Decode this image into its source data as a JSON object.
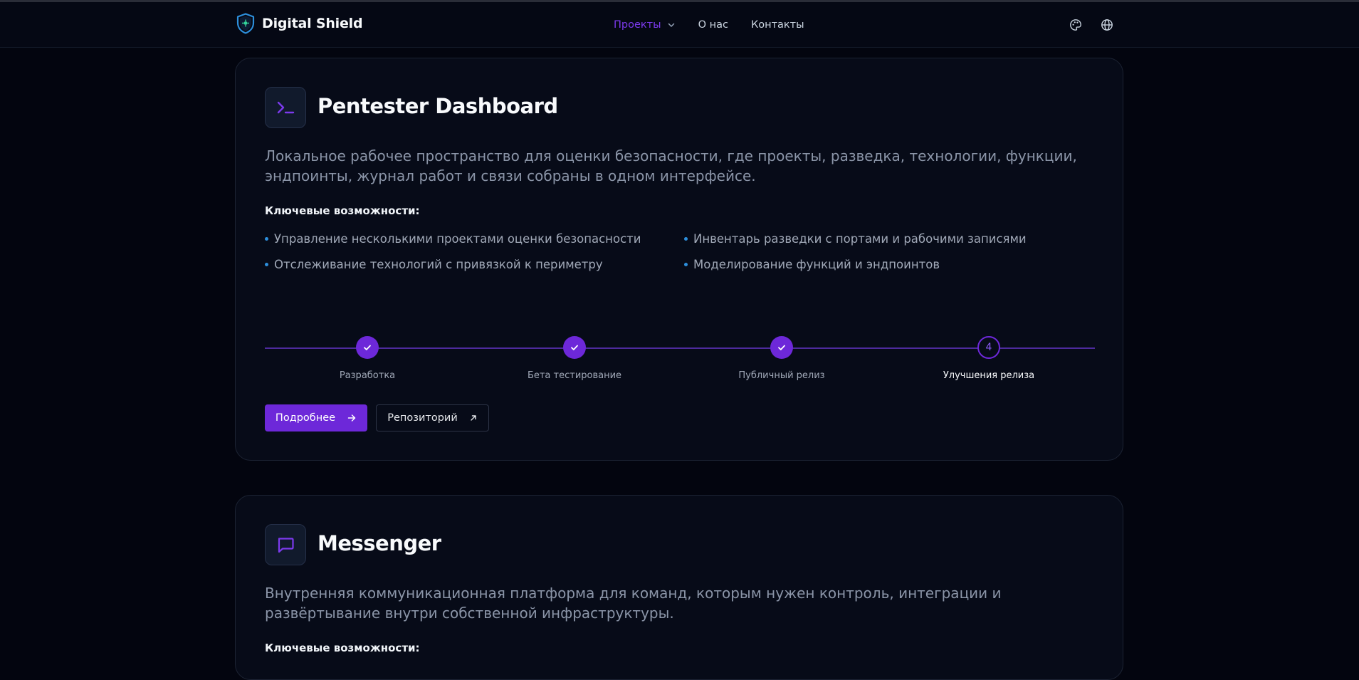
{
  "brand": {
    "name": "Digital Shield"
  },
  "nav": {
    "links": [
      {
        "label": "Проекты",
        "active": true
      },
      {
        "label": "О нас"
      },
      {
        "label": "Контакты"
      }
    ],
    "icons": [
      "palette-icon",
      "globe-icon"
    ]
  },
  "colors": {
    "accent": "#6d28d9",
    "accent_text": "#7c3aed",
    "bullet": "#2d8fdc",
    "background": "#03050f",
    "card": "#070b18"
  },
  "projects": [
    {
      "title": "Pentester Dashboard",
      "icon": "terminal-icon",
      "description": "Локальное рабочее пространство для оценки безопасности, где проекты, разведка, технологии, функции, эндпоинты, журнал работ и связи собраны в одном интерфейсе.",
      "features_heading": "Ключевые возможности:",
      "features": [
        "Управление несколькими проектами оценки безопасности",
        "Инвентарь разведки с портами и рабочими записями",
        "Отслеживание технологий с привязкой к периметру",
        "Моделирование функций и эндпоинтов"
      ],
      "stages": [
        {
          "label": "Разработка",
          "status": "done"
        },
        {
          "label": "Бета тестирование",
          "status": "done"
        },
        {
          "label": "Публичный релиз",
          "status": "done"
        },
        {
          "label": "Улучшения релиза",
          "status": "current",
          "number": "4"
        }
      ],
      "buttons": {
        "more": "Подробнее",
        "repo": "Репозиторий"
      }
    },
    {
      "title": "Messenger",
      "icon": "chat-icon",
      "description": "Внутренняя коммуникационная платформа для команд, которым нужен контроль, интеграции и развёртывание внутри собственной инфраструктуры.",
      "features_heading": "Ключевые возможности:"
    }
  ]
}
